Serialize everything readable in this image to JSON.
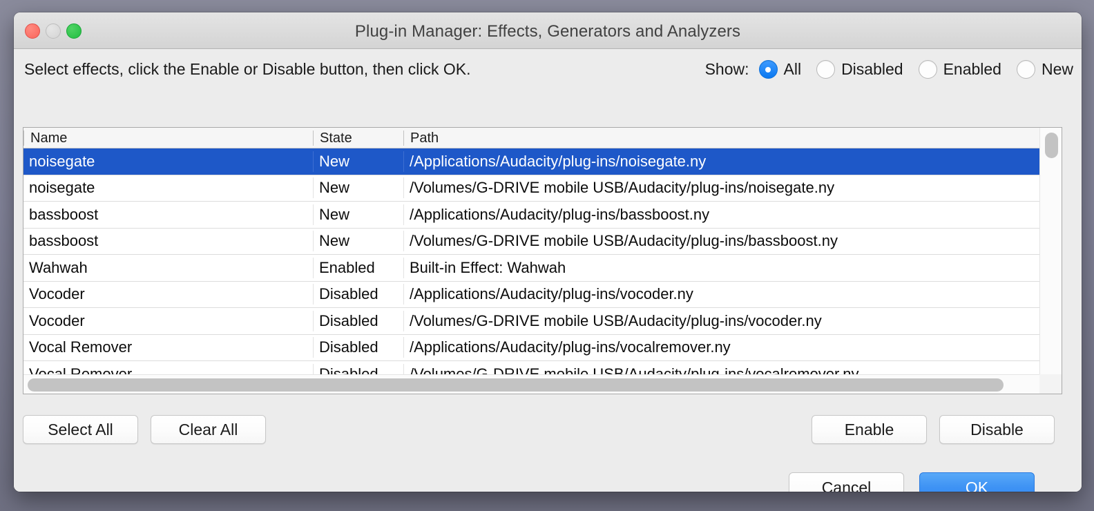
{
  "window": {
    "title": "Plug-in Manager: Effects, Generators and Analyzers",
    "traffic_lights": {
      "close": "close",
      "minimize": "minimize",
      "maximize": "maximize"
    }
  },
  "instruction": "Select effects, click the Enable or Disable button, then click OK.",
  "show": {
    "label": "Show:",
    "options": [
      {
        "label": "All",
        "selected": true
      },
      {
        "label": "Disabled",
        "selected": false
      },
      {
        "label": "Enabled",
        "selected": false
      },
      {
        "label": "New",
        "selected": false
      }
    ]
  },
  "table": {
    "columns": [
      "Name",
      "State",
      "Path"
    ],
    "rows": [
      {
        "name": "noisegate",
        "state": "New",
        "path": "/Applications/Audacity/plug-ins/noisegate.ny",
        "selected": true
      },
      {
        "name": "noisegate",
        "state": "New",
        "path": "/Volumes/G-DRIVE mobile USB/Audacity/plug-ins/noisegate.ny",
        "selected": false
      },
      {
        "name": "bassboost",
        "state": "New",
        "path": "/Applications/Audacity/plug-ins/bassboost.ny",
        "selected": false
      },
      {
        "name": "bassboost",
        "state": "New",
        "path": "/Volumes/G-DRIVE mobile USB/Audacity/plug-ins/bassboost.ny",
        "selected": false
      },
      {
        "name": "Wahwah",
        "state": "Enabled",
        "path": "Built-in Effect: Wahwah",
        "selected": false
      },
      {
        "name": "Vocoder",
        "state": "Disabled",
        "path": "/Applications/Audacity/plug-ins/vocoder.ny",
        "selected": false
      },
      {
        "name": "Vocoder",
        "state": "Disabled",
        "path": "/Volumes/G-DRIVE mobile USB/Audacity/plug-ins/vocoder.ny",
        "selected": false
      },
      {
        "name": "Vocal Remover",
        "state": "Disabled",
        "path": "/Applications/Audacity/plug-ins/vocalremover.ny",
        "selected": false
      },
      {
        "name": "Vocal Remover",
        "state": "Disabled",
        "path": "/Volumes/G-DRIVE mobile USB/Audacity/plug-ins/vocalremover.ny",
        "selected": false
      }
    ]
  },
  "buttons": {
    "select_all": "Select All",
    "clear_all": "Clear All",
    "enable": "Enable",
    "disable": "Disable",
    "cancel": "Cancel",
    "ok": "OK"
  },
  "colors": {
    "selection_blue": "#1e58c8",
    "accent_blue": "#3f93f4",
    "radio_blue": "#0a78f0",
    "window_bg": "#ececec",
    "desktop_bg": "#83849a"
  }
}
